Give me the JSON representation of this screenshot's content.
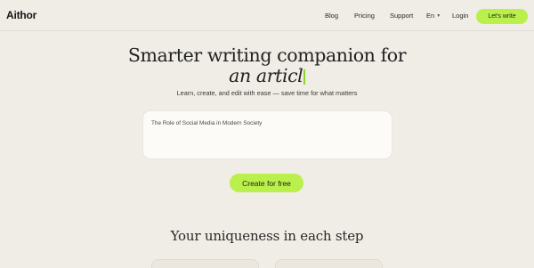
{
  "header": {
    "logo": "Aithor",
    "nav": {
      "blog": "Blog",
      "pricing": "Pricing",
      "support": "Support",
      "language": "En",
      "login": "Login"
    },
    "cta": "Let's write"
  },
  "hero": {
    "title_line1": "Smarter writing companion for",
    "title_line2_typed": "an articl",
    "subtitle": "Learn, create, and edit with ease — save time for what matters"
  },
  "topic_input": {
    "value": "The Role of Social Media in Modern Society"
  },
  "main_cta": "Create for free",
  "section": {
    "title": "Your uniqueness in each step"
  },
  "colors": {
    "accent": "#b9f04b",
    "background": "#f0ece6",
    "card": "#fdfbf7",
    "caret": "#8bd62e"
  }
}
